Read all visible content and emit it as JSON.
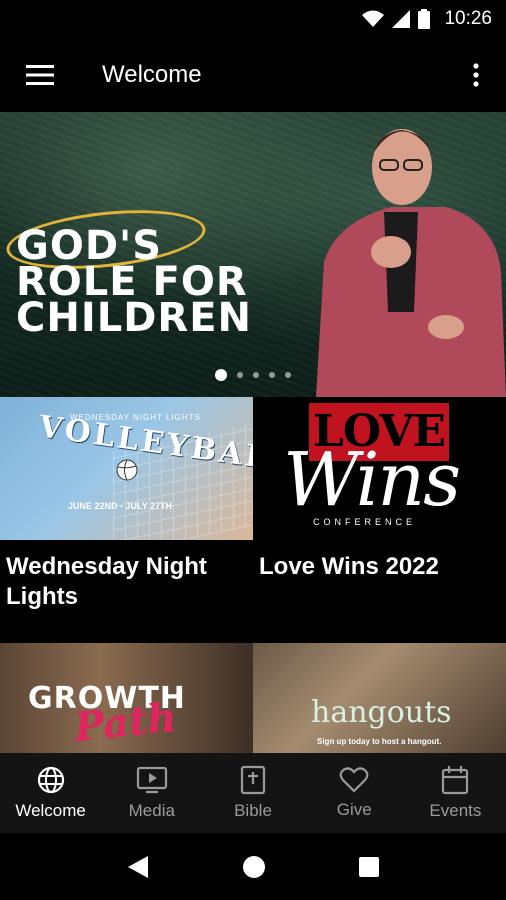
{
  "status_bar": {
    "time": "10:26"
  },
  "app_bar": {
    "title": "Welcome"
  },
  "hero": {
    "title_lines": [
      "GOD'S",
      "ROLE FOR",
      "CHILDREN"
    ],
    "dots_count": 5,
    "active_dot": 0
  },
  "cards": [
    {
      "title": "Wednesday Night Lights",
      "thumb_texts": {
        "small": "WEDNESDAY NIGHT LIGHTS",
        "big": "VOLLEYBALL",
        "date": "JUNE 22ND - JULY 27TH"
      }
    },
    {
      "title": "Love Wins 2022",
      "thumb_texts": {
        "love": "LOVE",
        "wins": "Wins",
        "conf": "CONFERENCE"
      }
    },
    {
      "title": "",
      "thumb_texts": {
        "growth": "GROWTH",
        "path": "Path"
      }
    },
    {
      "title": "",
      "thumb_texts": {
        "title": "hangouts",
        "sub": "Sign up today to host a hangout."
      }
    }
  ],
  "bottom_nav": {
    "items": [
      {
        "label": "Welcome",
        "icon": "globe-icon",
        "active": true
      },
      {
        "label": "Media",
        "icon": "tv-play-icon",
        "active": false
      },
      {
        "label": "Bible",
        "icon": "bible-icon",
        "active": false
      },
      {
        "label": "Give",
        "icon": "heart-icon",
        "active": false
      },
      {
        "label": "Events",
        "icon": "calendar-icon",
        "active": false
      }
    ]
  },
  "colors": {
    "background": "#000000",
    "nav_bg": "#141414",
    "accent_gold": "#e0b33a",
    "love_red": "#c1121f"
  }
}
